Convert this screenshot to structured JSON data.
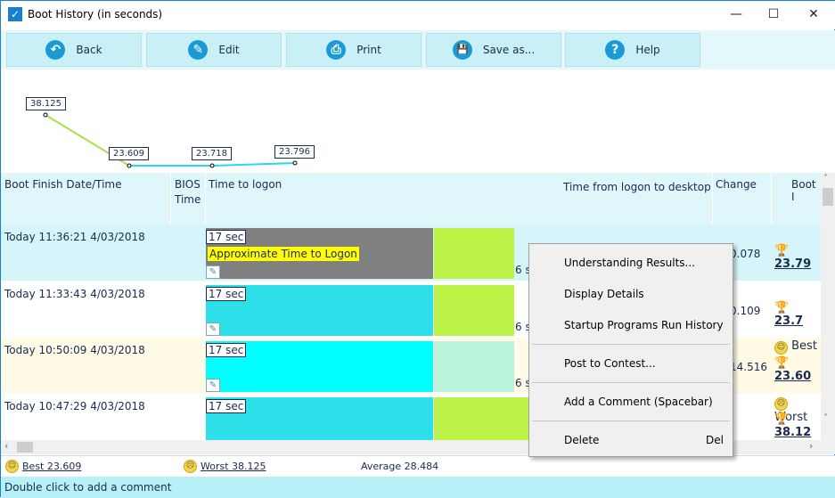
{
  "window": {
    "title": "Boot History (in seconds)",
    "minimize": "—",
    "maximize": "☐",
    "close": "✕"
  },
  "toolbar": [
    {
      "label": "Back",
      "icon": "back-arrow-icon",
      "glyph": "↶"
    },
    {
      "label": "Edit",
      "icon": "edit-icon",
      "glyph": "✎"
    },
    {
      "label": "Print",
      "icon": "printer-icon",
      "glyph": "⎙"
    },
    {
      "label": "Save as...",
      "icon": "save-icon",
      "glyph": "💾"
    },
    {
      "label": "Help",
      "icon": "help-icon",
      "glyph": "?"
    }
  ],
  "chart_data": {
    "type": "line",
    "values": [
      38.125,
      23.609,
      23.718,
      23.796
    ],
    "labels": [
      "38.125",
      "23.609",
      "23.718",
      "23.796"
    ],
    "colors": [
      "#a8e04a",
      "#2bd7ea"
    ]
  },
  "columns": {
    "date": "Boot Finish Date/Time",
    "bios": "BIOS",
    "bios2": "Time",
    "logon": "Time to logon",
    "desktop": "Time from logon to desktop",
    "change": "Change",
    "boot": "Boot I"
  },
  "rows": [
    {
      "date": "Today  11:36:21 4/03/2018",
      "sec": "17 sec",
      "tooltip": "Approximate Time to Logon",
      "six": "6 s",
      "change": "0.078",
      "boot": "23.79"
    },
    {
      "date": "Today  11:33:43 4/03/2018",
      "sec": "17 sec",
      "six": "6 s",
      "change": "0.109",
      "boot": "23.7"
    },
    {
      "date": "Today  10:50:09 4/03/2018",
      "sec": "17 sec",
      "six": "6 s",
      "change": "14.516",
      "badge": "Best",
      "boot": "23.60"
    },
    {
      "date": "Today  10:47:29 4/03/2018",
      "sec": "17 sec",
      "badge": "Worst",
      "boot": "38.12"
    }
  ],
  "menu": {
    "items": [
      "Understanding Results...",
      "Display Details",
      "Startup Programs Run History",
      "Post to Contest...",
      "Add a Comment (Spacebar)",
      "Delete"
    ],
    "delete_shortcut": "Del"
  },
  "status": {
    "best": "Best 23.609",
    "worst": "Worst 38.125",
    "average": "Average 28.484"
  },
  "footer": "Double click to add a comment"
}
